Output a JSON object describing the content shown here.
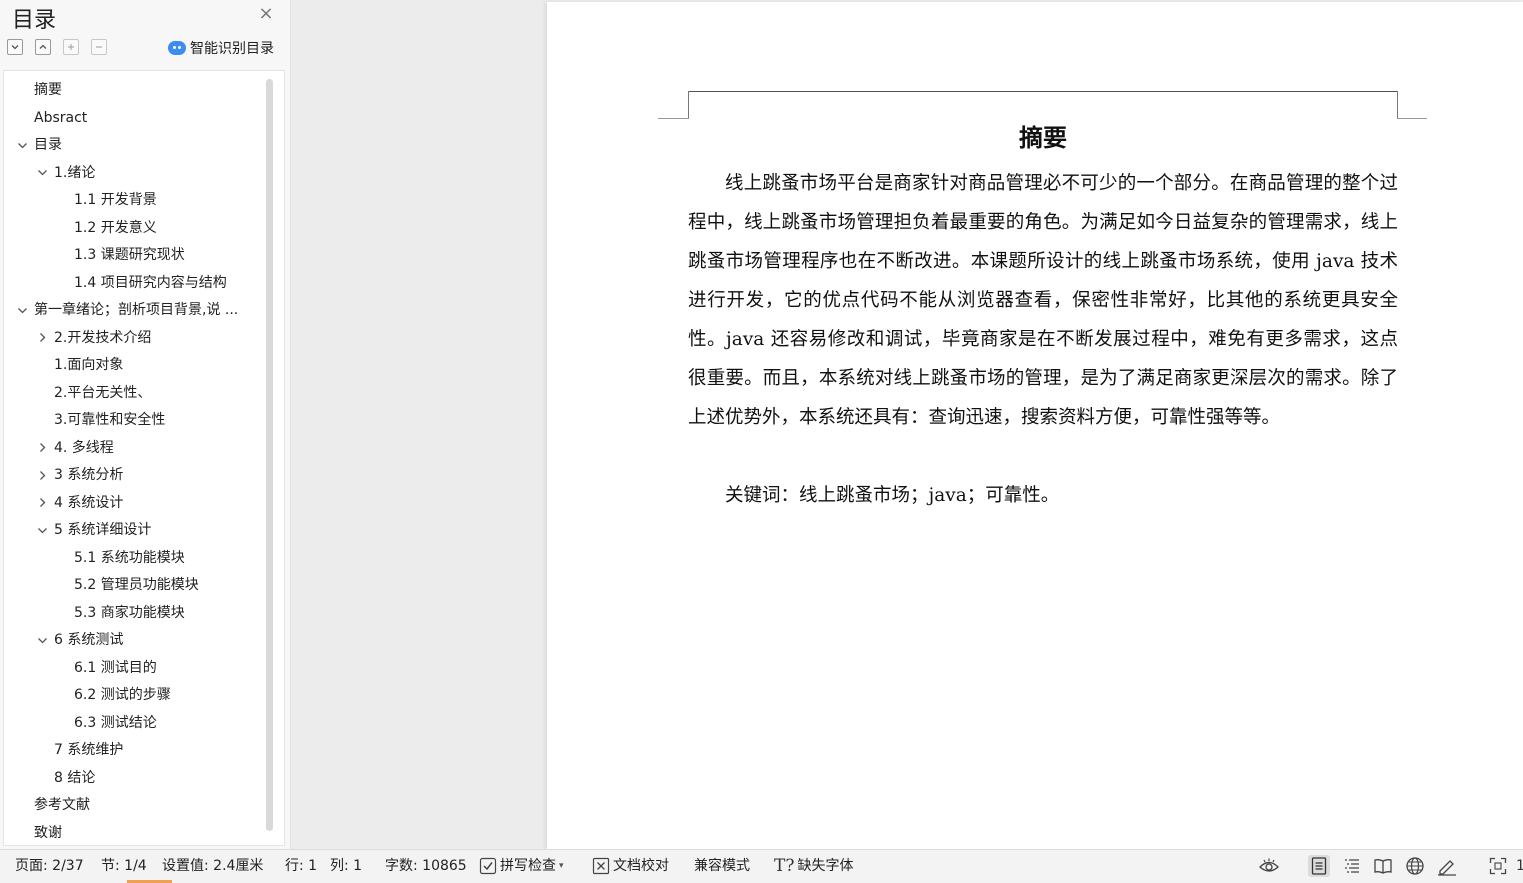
{
  "sidebar": {
    "title": "目录",
    "smart_toc_label": "智能识别目录",
    "toc": [
      {
        "label": "摘要",
        "level": 0
      },
      {
        "label": "Absract",
        "level": 0
      },
      {
        "label": "目录",
        "level": 0,
        "expander": "expanded"
      },
      {
        "label": "1.绪论",
        "level": 1,
        "expander": "expanded"
      },
      {
        "label": "1.1 开发背景",
        "level": 2
      },
      {
        "label": "1.2 开发意义",
        "level": 2
      },
      {
        "label": "1.3 课题研究现状",
        "level": 2
      },
      {
        "label": "1.4 项目研究内容与结构",
        "level": 2
      },
      {
        "label": "第一章绪论；剖析项目背景,说 ...",
        "level": 0,
        "expander": "expanded",
        "bold": true
      },
      {
        "label": "2.开发技术介绍",
        "level": 1,
        "expander": "collapsed"
      },
      {
        "label": "1.面向对象",
        "level": 1
      },
      {
        "label": "2.平台无关性、",
        "level": 1
      },
      {
        "label": "3.可靠性和安全性",
        "level": 1
      },
      {
        "label": "4. 多线程",
        "level": 1,
        "expander": "collapsed"
      },
      {
        "label": "3 系统分析",
        "level": 1,
        "expander": "collapsed"
      },
      {
        "label": "4 系统设计",
        "level": 1,
        "expander": "collapsed"
      },
      {
        "label": "5  系统详细设计",
        "level": 1,
        "expander": "expanded"
      },
      {
        "label": "5.1 系统功能模块",
        "level": 2
      },
      {
        "label": "5.2 管理员功能模块",
        "level": 2
      },
      {
        "label": "5.3 商家功能模块",
        "level": 2
      },
      {
        "label": "6  系统测试",
        "level": 1,
        "expander": "expanded"
      },
      {
        "label": "6.1  测试目的",
        "level": 2
      },
      {
        "label": "6.2  测试的步骤",
        "level": 2
      },
      {
        "label": "6.3 测试结论",
        "level": 2
      },
      {
        "label": "7  系统维护",
        "level": 1
      },
      {
        "label": "8  结论",
        "level": 1
      },
      {
        "label": "参考文献",
        "level": 0
      },
      {
        "label": "致谢",
        "level": 0
      }
    ]
  },
  "document": {
    "heading": "摘要",
    "body": "线上跳蚤市场平台是商家针对商品管理必不可少的一个部分。在商品管理的整个过程中，线上跳蚤市场管理担负着最重要的角色。为满足如今日益复杂的管理需求，线上跳蚤市场管理程序也在不断改进。本课题所设计的线上跳蚤市场系统，使用 java 技术进行开发，它的优点代码不能从浏览器查看，保密性非常好，比其他的系统更具安全性。java 还容易修改和调试，毕竟商家是在不断发展过程中，难免有更多需求，这点很重要。而且，本系统对线上跳蚤市场的管理，是为了满足商家更深层次的需求。除了上述优势外，本系统还具有：查询迅速，搜索资料方便，可靠性强等等。",
    "keywords": "关键词：线上跳蚤市场；java；可靠性。"
  },
  "statusbar": {
    "page": "页面: 2/37",
    "section": "节: 1/4",
    "setting": "设置值: 2.4厘米",
    "row": "行: 1",
    "col": "列: 1",
    "words": "字数: 10865",
    "spellcheck": "拼写检查",
    "proofread": "文档校对",
    "compat": "兼容模式",
    "missing_font": "缺失字体"
  },
  "colors": {
    "accent": "#3d8cf0",
    "bottom_accent": "#f0a050"
  }
}
